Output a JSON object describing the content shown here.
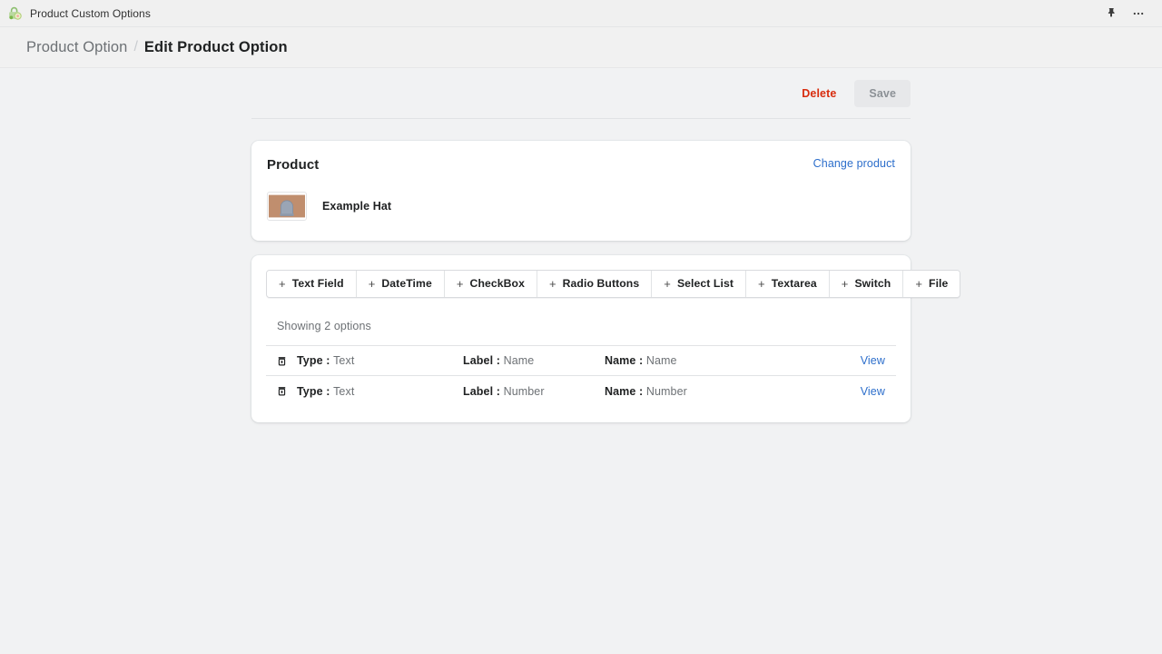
{
  "appbar": {
    "logo_icon": "lock-gear-icon",
    "title": "Product Custom Options",
    "pin_icon": "pin-icon",
    "more_icon": "more-horizontal-icon"
  },
  "breadcrumb": {
    "parent": "Product Option",
    "separator": "/",
    "current": "Edit Product Option"
  },
  "actions": {
    "delete_label": "Delete",
    "save_label": "Save",
    "delete_color": "#d82c0d",
    "save_disabled_bg": "#e7e8ea",
    "save_disabled_color": "#8c9196"
  },
  "product_card": {
    "title": "Product",
    "change_link": "Change product",
    "product_name": "Example Hat",
    "thumbnail_icon": "hat-product-thumbnail",
    "thumbnail_bg": "#c08e6e",
    "thumbnail_shape_color": "#9aa5b5"
  },
  "options_card": {
    "add_buttons": [
      {
        "icon": "plus-icon",
        "label": "Text Field"
      },
      {
        "icon": "plus-icon",
        "label": "DateTime"
      },
      {
        "icon": "plus-icon",
        "label": "CheckBox"
      },
      {
        "icon": "plus-icon",
        "label": "Radio Buttons"
      },
      {
        "icon": "plus-icon",
        "label": "Select List"
      },
      {
        "icon": "plus-icon",
        "label": "Textarea"
      },
      {
        "icon": "plus-icon",
        "label": "Switch"
      },
      {
        "icon": "plus-icon",
        "label": "File"
      }
    ],
    "showing_text": "Showing 2 options",
    "columns": {
      "type": "Type :",
      "label": "Label :",
      "name": "Name :"
    },
    "view_label": "View",
    "grip_icon": "drag-handle-icon",
    "rows": [
      {
        "type": "Text",
        "label": "Name",
        "name": "Name",
        "view": "View"
      },
      {
        "type": "Text",
        "label": "Number",
        "name": "Number",
        "view": "View"
      }
    ]
  },
  "theme": {
    "page_bg": "#f1f2f3",
    "card_bg": "#ffffff",
    "link_color": "#2c6ecb",
    "text_primary": "#202223",
    "text_subdued": "#6d7175"
  }
}
